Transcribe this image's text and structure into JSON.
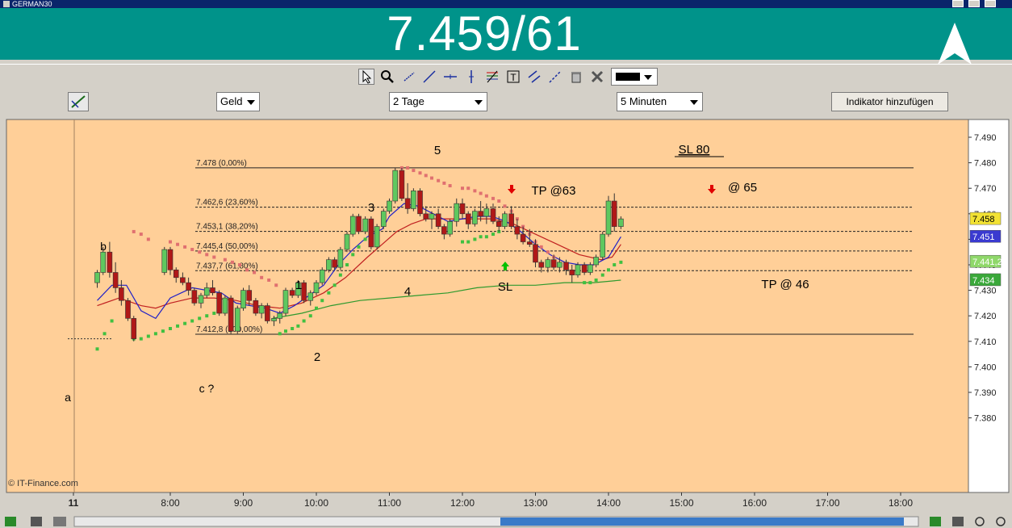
{
  "window": {
    "title": "GERMAN30"
  },
  "quote": {
    "text": "7.459/61"
  },
  "toolbar": {
    "tools": [
      "cursor-icon",
      "zoom-icon",
      "line-icon",
      "trendline-icon",
      "horizontal-line-icon",
      "vertical-line-icon",
      "fibonacci-icon",
      "text-icon",
      "channel-icon",
      "parallel-lines-icon",
      "trash-icon",
      "tools-icon"
    ],
    "line_color": "#000000"
  },
  "controls": {
    "price_type": "Geld",
    "period": "2 Tage",
    "interval": "5 Minuten",
    "add_indicator": "Indikator hinzufügen"
  },
  "chart_data": {
    "type": "candlestick",
    "instrument": "GERMAN30",
    "copyright": "© IT-Finance.com",
    "y_axis": {
      "min": 7380,
      "max": 7495,
      "ticks": [
        "7.490",
        "7.480",
        "7.470",
        "7.460",
        "7.450",
        "7.440",
        "7.430",
        "7.420",
        "7.410",
        "7.400",
        "7.390",
        "7.380"
      ]
    },
    "x_axis": {
      "ticks": [
        "11",
        "8:00",
        "9:00",
        "10:00",
        "11:00",
        "12:00",
        "13:00",
        "14:00",
        "15:00",
        "16:00",
        "17:00",
        "18:00"
      ]
    },
    "price_tags": [
      {
        "value": "7.458",
        "bg": "#f2e233"
      },
      {
        "value": "7.451",
        "bg": "#3a3ad0"
      },
      {
        "value": "7.441,2",
        "bg": "#8fd86a"
      },
      {
        "value": "7.434",
        "bg": "#3aa83a"
      }
    ],
    "fibonacci": [
      {
        "label": "7.478 (0,00%)",
        "value": 7478,
        "solid": true
      },
      {
        "label": "7.462,6 (23,60%)",
        "value": 7462.6,
        "solid": false
      },
      {
        "label": "7.453,1 (38,20%)",
        "value": 7453.1,
        "solid": false
      },
      {
        "label": "7.445,4 (50,00%)",
        "value": 7445.4,
        "solid": false
      },
      {
        "label": "7.437,7 (61,80%)",
        "value": 7437.7,
        "solid": false
      },
      {
        "label": "7.412,8 (100,00%)",
        "value": 7412.8,
        "solid": true
      }
    ],
    "annotations": [
      "a",
      "b",
      "c ?",
      "1",
      "2",
      "3",
      "4",
      "5",
      "SL",
      "TP @63",
      "SL 80",
      "@ 65",
      "TP @ 46"
    ],
    "candles": [
      {
        "t": 7.0,
        "o": 7433,
        "h": 7438,
        "l": 7431,
        "c": 7437
      },
      {
        "t": 7.08,
        "o": 7437,
        "h": 7447,
        "l": 7436,
        "c": 7445
      },
      {
        "t": 7.17,
        "o": 7445,
        "h": 7449,
        "l": 7435,
        "c": 7437
      },
      {
        "t": 7.25,
        "o": 7437,
        "h": 7441,
        "l": 7429,
        "c": 7431
      },
      {
        "t": 7.33,
        "o": 7431,
        "h": 7434,
        "l": 7424,
        "c": 7426
      },
      {
        "t": 7.42,
        "o": 7426,
        "h": 7427,
        "l": 7418,
        "c": 7419
      },
      {
        "t": 7.5,
        "o": 7419,
        "h": 7420,
        "l": 7410,
        "c": 7411
      },
      {
        "t": 7.92,
        "o": 7437,
        "h": 7447,
        "l": 7436,
        "c": 7446
      },
      {
        "t": 8.0,
        "o": 7446,
        "h": 7447,
        "l": 7436,
        "c": 7438
      },
      {
        "t": 8.08,
        "o": 7438,
        "h": 7439,
        "l": 7433,
        "c": 7435
      },
      {
        "t": 8.17,
        "o": 7435,
        "h": 7437,
        "l": 7432,
        "c": 7433
      },
      {
        "t": 8.25,
        "o": 7433,
        "h": 7435,
        "l": 7428,
        "c": 7430
      },
      {
        "t": 8.33,
        "o": 7430,
        "h": 7431,
        "l": 7424,
        "c": 7425
      },
      {
        "t": 8.42,
        "o": 7425,
        "h": 7429,
        "l": 7423,
        "c": 7428
      },
      {
        "t": 8.5,
        "o": 7428,
        "h": 7433,
        "l": 7427,
        "c": 7431
      },
      {
        "t": 8.58,
        "o": 7431,
        "h": 7434,
        "l": 7428,
        "c": 7429
      },
      {
        "t": 8.67,
        "o": 7429,
        "h": 7430,
        "l": 7420,
        "c": 7421
      },
      {
        "t": 8.75,
        "o": 7421,
        "h": 7428,
        "l": 7420,
        "c": 7427
      },
      {
        "t": 8.83,
        "o": 7427,
        "h": 7428,
        "l": 7413,
        "c": 7414
      },
      {
        "t": 8.92,
        "o": 7414,
        "h": 7424,
        "l": 7413,
        "c": 7423
      },
      {
        "t": 9.0,
        "o": 7423,
        "h": 7431,
        "l": 7422,
        "c": 7430
      },
      {
        "t": 9.08,
        "o": 7430,
        "h": 7432,
        "l": 7424,
        "c": 7426
      },
      {
        "t": 9.17,
        "o": 7426,
        "h": 7427,
        "l": 7420,
        "c": 7421
      },
      {
        "t": 9.25,
        "o": 7421,
        "h": 7425,
        "l": 7419,
        "c": 7424
      },
      {
        "t": 9.33,
        "o": 7424,
        "h": 7425,
        "l": 7417,
        "c": 7418
      },
      {
        "t": 9.42,
        "o": 7418,
        "h": 7420,
        "l": 7416,
        "c": 7419
      },
      {
        "t": 9.5,
        "o": 7419,
        "h": 7422,
        "l": 7417,
        "c": 7421
      },
      {
        "t": 9.58,
        "o": 7421,
        "h": 7431,
        "l": 7420,
        "c": 7430
      },
      {
        "t": 9.67,
        "o": 7430,
        "h": 7431,
        "l": 7427,
        "c": 7428
      },
      {
        "t": 9.75,
        "o": 7428,
        "h": 7434,
        "l": 7427,
        "c": 7433
      },
      {
        "t": 9.83,
        "o": 7433,
        "h": 7434,
        "l": 7425,
        "c": 7426
      },
      {
        "t": 9.92,
        "o": 7426,
        "h": 7430,
        "l": 7424,
        "c": 7429
      },
      {
        "t": 10.0,
        "o": 7429,
        "h": 7434,
        "l": 7428,
        "c": 7433
      },
      {
        "t": 10.08,
        "o": 7433,
        "h": 7439,
        "l": 7432,
        "c": 7438
      },
      {
        "t": 10.17,
        "o": 7438,
        "h": 7443,
        "l": 7437,
        "c": 7442
      },
      {
        "t": 10.25,
        "o": 7442,
        "h": 7443,
        "l": 7438,
        "c": 7439
      },
      {
        "t": 10.33,
        "o": 7439,
        "h": 7447,
        "l": 7438,
        "c": 7446
      },
      {
        "t": 10.42,
        "o": 7446,
        "h": 7453,
        "l": 7445,
        "c": 7452
      },
      {
        "t": 10.5,
        "o": 7452,
        "h": 7460,
        "l": 7451,
        "c": 7459
      },
      {
        "t": 10.58,
        "o": 7459,
        "h": 7460,
        "l": 7452,
        "c": 7453
      },
      {
        "t": 10.67,
        "o": 7453,
        "h": 7459,
        "l": 7452,
        "c": 7458
      },
      {
        "t": 10.75,
        "o": 7458,
        "h": 7459,
        "l": 7446,
        "c": 7447
      },
      {
        "t": 10.83,
        "o": 7447,
        "h": 7456,
        "l": 7446,
        "c": 7455
      },
      {
        "t": 10.92,
        "o": 7455,
        "h": 7462,
        "l": 7454,
        "c": 7461
      },
      {
        "t": 11.0,
        "o": 7461,
        "h": 7466,
        "l": 7460,
        "c": 7465
      },
      {
        "t": 11.08,
        "o": 7465,
        "h": 7478,
        "l": 7464,
        "c": 7477
      },
      {
        "t": 11.17,
        "o": 7477,
        "h": 7478,
        "l": 7465,
        "c": 7466
      },
      {
        "t": 11.25,
        "o": 7466,
        "h": 7472,
        "l": 7460,
        "c": 7462
      },
      {
        "t": 11.33,
        "o": 7462,
        "h": 7470,
        "l": 7461,
        "c": 7469
      },
      {
        "t": 11.42,
        "o": 7469,
        "h": 7470,
        "l": 7459,
        "c": 7460
      },
      {
        "t": 11.5,
        "o": 7460,
        "h": 7463,
        "l": 7457,
        "c": 7458
      },
      {
        "t": 11.58,
        "o": 7458,
        "h": 7461,
        "l": 7454,
        "c": 7460
      },
      {
        "t": 11.67,
        "o": 7460,
        "h": 7462,
        "l": 7454,
        "c": 7455
      },
      {
        "t": 11.75,
        "o": 7455,
        "h": 7456,
        "l": 7450,
        "c": 7452
      },
      {
        "t": 11.83,
        "o": 7452,
        "h": 7458,
        "l": 7451,
        "c": 7457
      },
      {
        "t": 11.92,
        "o": 7457,
        "h": 7466,
        "l": 7455,
        "c": 7464
      },
      {
        "t": 12.0,
        "o": 7464,
        "h": 7466,
        "l": 7458,
        "c": 7460
      },
      {
        "t": 12.08,
        "o": 7460,
        "h": 7461,
        "l": 7454,
        "c": 7456
      },
      {
        "t": 12.17,
        "o": 7456,
        "h": 7462,
        "l": 7455,
        "c": 7461
      },
      {
        "t": 12.25,
        "o": 7461,
        "h": 7465,
        "l": 7457,
        "c": 7459
      },
      {
        "t": 12.33,
        "o": 7459,
        "h": 7464,
        "l": 7456,
        "c": 7462
      },
      {
        "t": 12.42,
        "o": 7462,
        "h": 7464,
        "l": 7456,
        "c": 7457
      },
      {
        "t": 12.5,
        "o": 7457,
        "h": 7459,
        "l": 7453,
        "c": 7455
      },
      {
        "t": 12.58,
        "o": 7455,
        "h": 7461,
        "l": 7454,
        "c": 7460
      },
      {
        "t": 12.67,
        "o": 7460,
        "h": 7463,
        "l": 7454,
        "c": 7455
      },
      {
        "t": 12.75,
        "o": 7455,
        "h": 7458,
        "l": 7450,
        "c": 7452
      },
      {
        "t": 12.83,
        "o": 7452,
        "h": 7455,
        "l": 7448,
        "c": 7449
      },
      {
        "t": 12.92,
        "o": 7449,
        "h": 7454,
        "l": 7447,
        "c": 7448
      },
      {
        "t": 13.0,
        "o": 7448,
        "h": 7450,
        "l": 7439,
        "c": 7441
      },
      {
        "t": 13.08,
        "o": 7441,
        "h": 7442,
        "l": 7437,
        "c": 7439
      },
      {
        "t": 13.17,
        "o": 7439,
        "h": 7443,
        "l": 7437,
        "c": 7442
      },
      {
        "t": 13.25,
        "o": 7442,
        "h": 7444,
        "l": 7438,
        "c": 7439
      },
      {
        "t": 13.33,
        "o": 7439,
        "h": 7443,
        "l": 7437,
        "c": 7441
      },
      {
        "t": 13.42,
        "o": 7441,
        "h": 7442,
        "l": 7436,
        "c": 7438
      },
      {
        "t": 13.5,
        "o": 7438,
        "h": 7440,
        "l": 7433,
        "c": 7436
      },
      {
        "t": 13.58,
        "o": 7436,
        "h": 7441,
        "l": 7435,
        "c": 7440
      },
      {
        "t": 13.67,
        "o": 7440,
        "h": 7441,
        "l": 7436,
        "c": 7437
      },
      {
        "t": 13.75,
        "o": 7437,
        "h": 7441,
        "l": 7436,
        "c": 7440
      },
      {
        "t": 13.83,
        "o": 7440,
        "h": 7444,
        "l": 7439,
        "c": 7443
      },
      {
        "t": 13.92,
        "o": 7443,
        "h": 7453,
        "l": 7442,
        "c": 7452
      },
      {
        "t": 14.0,
        "o": 7452,
        "h": 7467,
        "l": 7451,
        "c": 7465
      },
      {
        "t": 14.08,
        "o": 7465,
        "h": 7468,
        "l": 7453,
        "c": 7455
      },
      {
        "t": 14.17,
        "o": 7455,
        "h": 7459,
        "l": 7454,
        "c": 7458
      }
    ],
    "ma_blue": [
      [
        7.0,
        7426
      ],
      [
        7.2,
        7432
      ],
      [
        7.4,
        7432
      ],
      [
        7.6,
        7422
      ],
      [
        7.8,
        7419
      ],
      [
        8.0,
        7427
      ],
      [
        8.3,
        7431
      ],
      [
        8.5,
        7430
      ],
      [
        8.7,
        7429
      ],
      [
        8.9,
        7425
      ],
      [
        9.1,
        7424
      ],
      [
        9.3,
        7423
      ],
      [
        9.5,
        7421
      ],
      [
        9.7,
        7424
      ],
      [
        9.9,
        7428
      ],
      [
        10.1,
        7432
      ],
      [
        10.3,
        7440
      ],
      [
        10.5,
        7446
      ],
      [
        10.7,
        7451
      ],
      [
        10.9,
        7454
      ],
      [
        11.0,
        7459
      ],
      [
        11.2,
        7464
      ],
      [
        11.4,
        7463
      ],
      [
        11.6,
        7460
      ],
      [
        11.8,
        7457
      ],
      [
        12.0,
        7458
      ],
      [
        12.2,
        7459
      ],
      [
        12.4,
        7459
      ],
      [
        12.6,
        7457
      ],
      [
        12.8,
        7453
      ],
      [
        13.0,
        7448
      ],
      [
        13.2,
        7444
      ],
      [
        13.4,
        7441
      ],
      [
        13.6,
        7440
      ],
      [
        13.8,
        7440
      ],
      [
        14.0,
        7443
      ],
      [
        14.17,
        7451
      ]
    ],
    "ma_red": [
      [
        7.0,
        7424
      ],
      [
        7.3,
        7427
      ],
      [
        7.6,
        7424
      ],
      [
        7.8,
        7423
      ],
      [
        8.0,
        7425
      ],
      [
        8.3,
        7427
      ],
      [
        8.6,
        7427
      ],
      [
        8.9,
        7426
      ],
      [
        9.2,
        7424
      ],
      [
        9.5,
        7423
      ],
      [
        9.8,
        7425
      ],
      [
        10.1,
        7429
      ],
      [
        10.4,
        7435
      ],
      [
        10.7,
        7443
      ],
      [
        10.9,
        7448
      ],
      [
        11.1,
        7453
      ],
      [
        11.3,
        7456
      ],
      [
        11.5,
        7458
      ],
      [
        11.8,
        7458
      ],
      [
        12.1,
        7458
      ],
      [
        12.4,
        7458
      ],
      [
        12.7,
        7456
      ],
      [
        13.0,
        7452
      ],
      [
        13.3,
        7448
      ],
      [
        13.6,
        7444
      ],
      [
        13.9,
        7442
      ],
      [
        14.05,
        7443
      ],
      [
        14.17,
        7448
      ]
    ],
    "ma_green": [
      [
        9.4,
        7419
      ],
      [
        9.8,
        7421
      ],
      [
        10.2,
        7424
      ],
      [
        10.6,
        7426
      ],
      [
        11.0,
        7427
      ],
      [
        11.4,
        7428
      ],
      [
        11.8,
        7429
      ],
      [
        12.2,
        7431
      ],
      [
        12.6,
        7432
      ],
      [
        13.0,
        7432
      ],
      [
        13.4,
        7433
      ],
      [
        13.8,
        7433
      ],
      [
        14.17,
        7434
      ]
    ],
    "sar_red": [
      [
        7.5,
        7453
      ],
      [
        7.6,
        7452
      ],
      [
        7.7,
        7450
      ],
      [
        8.0,
        7449
      ],
      [
        8.1,
        7448
      ],
      [
        8.2,
        7447
      ],
      [
        8.3,
        7446
      ],
      [
        8.4,
        7445
      ],
      [
        8.5,
        7444
      ],
      [
        8.6,
        7443
      ],
      [
        8.75,
        7442
      ],
      [
        8.85,
        7441
      ],
      [
        8.95,
        7440
      ],
      [
        9.05,
        7438
      ],
      [
        9.15,
        7437
      ],
      [
        9.25,
        7435
      ],
      [
        9.35,
        7434
      ],
      [
        9.45,
        7432
      ],
      [
        11.17,
        7478
      ],
      [
        11.25,
        7478
      ],
      [
        11.33,
        7477
      ],
      [
        11.42,
        7476
      ],
      [
        11.5,
        7475
      ],
      [
        11.58,
        7474
      ],
      [
        11.67,
        7473
      ],
      [
        11.75,
        7472
      ],
      [
        11.83,
        7471
      ],
      [
        12.0,
        7470
      ],
      [
        12.08,
        7470
      ],
      [
        12.17,
        7469
      ],
      [
        12.25,
        7468
      ],
      [
        12.33,
        7467
      ],
      [
        12.42,
        7466
      ],
      [
        12.5,
        7465
      ],
      [
        12.58,
        7463
      ],
      [
        12.67,
        7461
      ],
      [
        12.75,
        7458
      ],
      [
        12.83,
        7455
      ],
      [
        12.92,
        7452
      ],
      [
        13.0,
        7449
      ],
      [
        13.08,
        7447
      ],
      [
        13.17,
        7445
      ],
      [
        13.25,
        7443
      ]
    ],
    "sar_green": [
      [
        7.0,
        7407
      ],
      [
        7.1,
        7413
      ],
      [
        7.2,
        7418
      ],
      [
        7.5,
        7411
      ],
      [
        7.6,
        7411
      ],
      [
        7.7,
        7412
      ],
      [
        7.8,
        7413
      ],
      [
        7.9,
        7414
      ],
      [
        8.0,
        7415
      ],
      [
        8.1,
        7416
      ],
      [
        8.2,
        7417
      ],
      [
        8.3,
        7418
      ],
      [
        8.4,
        7419
      ],
      [
        8.5,
        7420
      ],
      [
        8.6,
        7421
      ],
      [
        9.25,
        7422
      ],
      [
        9.33,
        7423
      ],
      [
        9.5,
        7413
      ],
      [
        9.58,
        7414
      ],
      [
        9.67,
        7415
      ],
      [
        9.75,
        7416
      ],
      [
        9.83,
        7418
      ],
      [
        9.92,
        7420
      ],
      [
        10.0,
        7423
      ],
      [
        10.08,
        7426
      ],
      [
        10.17,
        7429
      ],
      [
        10.25,
        7432
      ],
      [
        10.33,
        7436
      ],
      [
        10.42,
        7440
      ],
      [
        10.5,
        7444
      ],
      [
        10.58,
        7447
      ],
      [
        10.67,
        7450
      ],
      [
        12.0,
        7449
      ],
      [
        12.08,
        7449
      ],
      [
        12.17,
        7450
      ],
      [
        12.25,
        7451
      ],
      [
        12.33,
        7451
      ],
      [
        12.42,
        7452
      ],
      [
        12.5,
        7453
      ],
      [
        13.67,
        7433
      ],
      [
        13.75,
        7433
      ],
      [
        13.83,
        7434
      ],
      [
        13.92,
        7436
      ],
      [
        14.0,
        7438
      ],
      [
        14.08,
        7440
      ],
      [
        14.17,
        7441
      ]
    ]
  }
}
